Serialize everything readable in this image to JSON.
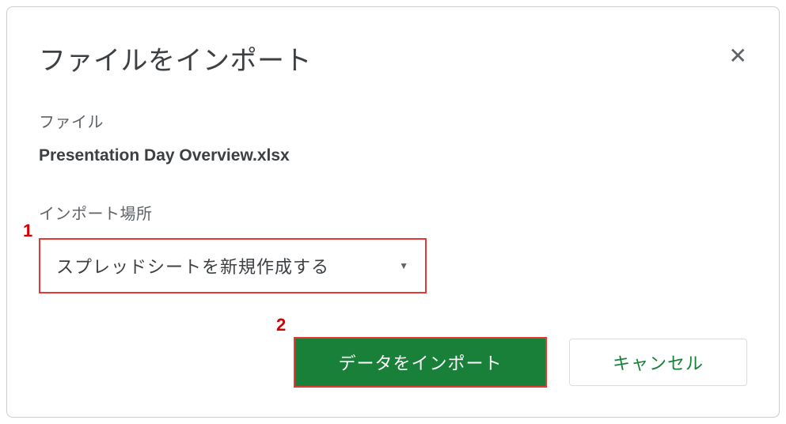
{
  "dialog": {
    "title": "ファイルをインポート",
    "file_label": "ファイル",
    "file_name": "Presentation Day Overview.xlsx",
    "location_label": "インポート場所",
    "dropdown_selected": "スプレッドシートを新規作成する",
    "import_button": "データをインポート",
    "cancel_button": "キャンセル",
    "close_symbol": "✕"
  },
  "annotations": {
    "marker1": "1",
    "marker2": "2"
  }
}
